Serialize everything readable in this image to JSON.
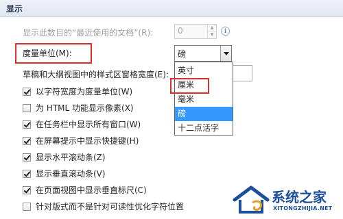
{
  "section": {
    "title": "显示"
  },
  "recent_docs": {
    "label": "显示此数目的“最近使用的文档”(R):",
    "value": "0"
  },
  "unit": {
    "label": "度量单位(M):",
    "selected": "磅",
    "options": [
      "英寸",
      "厘米",
      "毫米",
      "磅",
      "十二点活字"
    ],
    "highlighted_index": 3,
    "red_box_index": 1
  },
  "style_area_width": {
    "label": "草稿和大纲视图中的样式区窗格宽度(E):",
    "value": ""
  },
  "checkboxes": [
    {
      "label": "以字符宽度为度量单位(W)",
      "checked": true
    },
    {
      "label": "为 HTML 功能显示像素(X)",
      "checked": false
    },
    {
      "label": "在任务栏中显示所有窗口(W)",
      "checked": true
    },
    {
      "label": "在屏幕提示中显示快捷键(H)",
      "checked": true
    },
    {
      "label": "显示水平滚动条(Z)",
      "checked": true
    },
    {
      "label": "显示垂直滚动条(V)",
      "checked": true
    },
    {
      "label": "在页面视图中显示垂直标尺(C)",
      "checked": true
    },
    {
      "label": "针对版式而不是针对可读性优化字符位置",
      "checked": false
    }
  ],
  "watermark": {
    "title": "系统之家",
    "url": "XITONGZHIJIA.NET"
  },
  "colors": {
    "accent_red": "#d9302c",
    "selection_blue": "#3399ff",
    "brand_blue": "#1e4f9c"
  },
  "icons": {
    "info": "info-icon",
    "dropdown": "chevron-down-icon"
  }
}
